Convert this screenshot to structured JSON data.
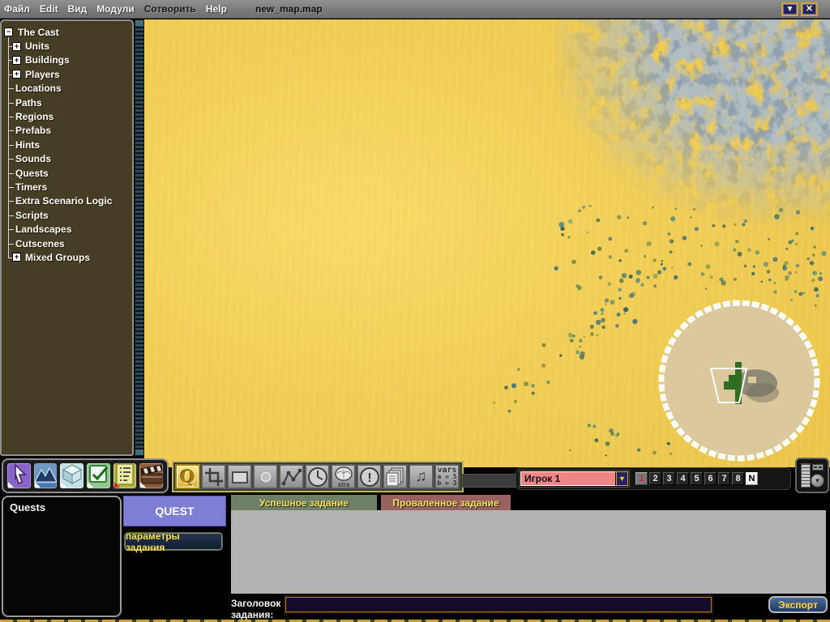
{
  "menu_bar": {
    "items": [
      {
        "label": "Файл",
        "dark": false
      },
      {
        "label": "Edit",
        "dark": false
      },
      {
        "label": "Вид",
        "dark": false
      },
      {
        "label": "Модули",
        "dark": false
      },
      {
        "label": "Сотворить",
        "dark": true
      },
      {
        "label": "Help",
        "dark": false
      }
    ],
    "document_title": "new_map.map"
  },
  "window_controls": {
    "minimize_glyph": "▼",
    "close_glyph": "✕"
  },
  "sidebar_tree": {
    "items": [
      {
        "label": "The Cast",
        "expander": "minus",
        "level": 0
      },
      {
        "label": "Units",
        "expander": "plus",
        "level": 1
      },
      {
        "label": "Buildings",
        "expander": "plus",
        "level": 1
      },
      {
        "label": "Players",
        "expander": "plus",
        "level": 1
      },
      {
        "label": "Locations",
        "expander": "none",
        "level": 1
      },
      {
        "label": "Paths",
        "expander": "none",
        "level": 1
      },
      {
        "label": "Regions",
        "expander": "none",
        "level": 1
      },
      {
        "label": "Prefabs",
        "expander": "none",
        "level": 1
      },
      {
        "label": "Hints",
        "expander": "none",
        "level": 1
      },
      {
        "label": "Sounds",
        "expander": "none",
        "level": 1
      },
      {
        "label": "Quests",
        "expander": "none",
        "level": 1
      },
      {
        "label": "Timers",
        "expander": "none",
        "level": 1
      },
      {
        "label": "Extra Scenario Logic",
        "expander": "none",
        "level": 1
      },
      {
        "label": "Scripts",
        "expander": "none",
        "level": 1
      },
      {
        "label": "Landscapes",
        "expander": "none",
        "level": 1
      },
      {
        "label": "Cutscenes",
        "expander": "none",
        "level": 1
      },
      {
        "label": "Mixed Groups",
        "expander": "plus",
        "level": 1
      }
    ]
  },
  "mode_toolbar": {
    "tools": [
      {
        "name": "select-cursor-tool",
        "tile_color": "#8a63c8",
        "marker": "white"
      },
      {
        "name": "landscape-tool",
        "tile_color": "#4a78b0",
        "marker": "white"
      },
      {
        "name": "objects-cube-tool",
        "tile_color": "#c4e2e6",
        "marker": "white"
      },
      {
        "name": "logic-check-tool",
        "tile_color": "#8cc88c",
        "marker": "white"
      },
      {
        "name": "script-list-tool",
        "tile_color": "#b4b442",
        "marker": "red"
      },
      {
        "name": "cutscene-clapper-tool",
        "tile_color": "#8e5a38",
        "marker": "white"
      }
    ]
  },
  "quest_toolbar": {
    "tools": [
      {
        "name": "quest-q-tool",
        "glyph": "Q",
        "selected": true
      },
      {
        "name": "crop-tool",
        "selected": false
      },
      {
        "name": "rect-region-tool",
        "selected": false
      },
      {
        "name": "ellipse-tool",
        "selected": false
      },
      {
        "name": "path-tool",
        "selected": false
      },
      {
        "name": "timer-clock-tool",
        "selected": false
      },
      {
        "name": "extra-logic-brain-tool",
        "caption": "xtra",
        "selected": false
      },
      {
        "name": "hint-exclamation-tool",
        "selected": false
      },
      {
        "name": "prefab-docs-tool",
        "selected": false
      },
      {
        "name": "sound-note-tool",
        "glyph": "♫",
        "selected": false
      },
      {
        "name": "vars-tool",
        "lines": [
          "vars",
          "a = 5",
          "b = 3"
        ],
        "selected": false
      }
    ]
  },
  "player_bar": {
    "selected_player": "Игрок 1",
    "dropdown_glyph": "▼",
    "buttons": [
      {
        "label": "1",
        "state": "active"
      },
      {
        "label": "2",
        "state": "normal"
      },
      {
        "label": "3",
        "state": "normal"
      },
      {
        "label": "4",
        "state": "normal"
      },
      {
        "label": "5",
        "state": "normal"
      },
      {
        "label": "6",
        "state": "normal"
      },
      {
        "label": "7",
        "state": "normal"
      },
      {
        "label": "8",
        "state": "normal"
      },
      {
        "label": "N",
        "state": "neutral"
      }
    ]
  },
  "device_panel": {
    "knob_glyph": "▼"
  },
  "quest_panel": {
    "list_title": "Quests",
    "quest_button_label": "QUEST",
    "params_button_label": "параметры задания",
    "success_tab_label": "Успешное задание",
    "failed_tab_label": "Проваленное задание",
    "quest_title_label": "Заголовок задания:",
    "quest_title_value": "",
    "export_button_label": "Экспорт"
  },
  "colors": {
    "sand": "#f1cd54",
    "rock": "#6b8199",
    "sidebar_bg": "#453e24",
    "selected_tool": "#e8c050",
    "player_field": "#f08585",
    "success_tab": "#6e8066",
    "failed_tab": "#9a6161",
    "quest_button": "#7e7ed4",
    "accent_gold": "#d2a62e"
  }
}
